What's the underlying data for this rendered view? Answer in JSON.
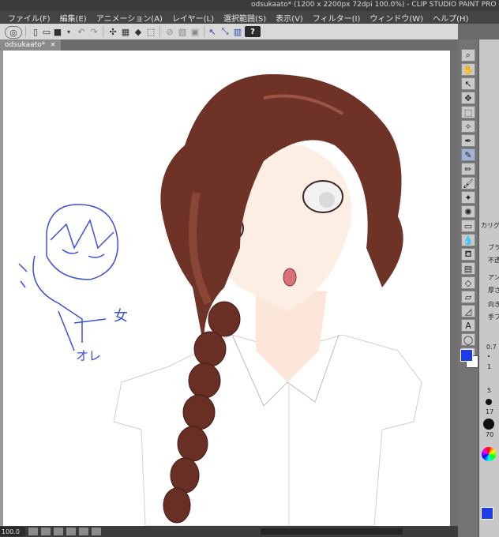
{
  "window": {
    "title": "odsukaato* (1200 x 2200px 72dpi 100.0%) - CLIP STUDIO PAINT PRO"
  },
  "menu": [
    "ファイル(F)",
    "編集(E)",
    "アニメーション(A)",
    "レイヤー(L)",
    "選択範囲(S)",
    "表示(V)",
    "フィルター(I)",
    "ウィンドウ(W)",
    "ヘルプ(H)"
  ],
  "command_bar": {
    "help_label": "?"
  },
  "document_tab": {
    "name": "odsukaato*",
    "close": "×"
  },
  "status": {
    "zoom": "100.0"
  },
  "sub_tool_panel": {
    "labels": [
      "カリグラフ",
      "ブラシ",
      "不透",
      "アン",
      "厚さ",
      "向き",
      "手ブ"
    ],
    "brush_sizes": [
      "0.7",
      "1",
      "5",
      "17",
      "70"
    ]
  },
  "canvas": {
    "sketch_text_1": "女",
    "sketch_text_2": "オレ"
  },
  "colors": {
    "main_color": "#1d3de6",
    "sub_color": "#ffffff",
    "hair": "#6e3326",
    "sketch": "#3a50d8"
  }
}
